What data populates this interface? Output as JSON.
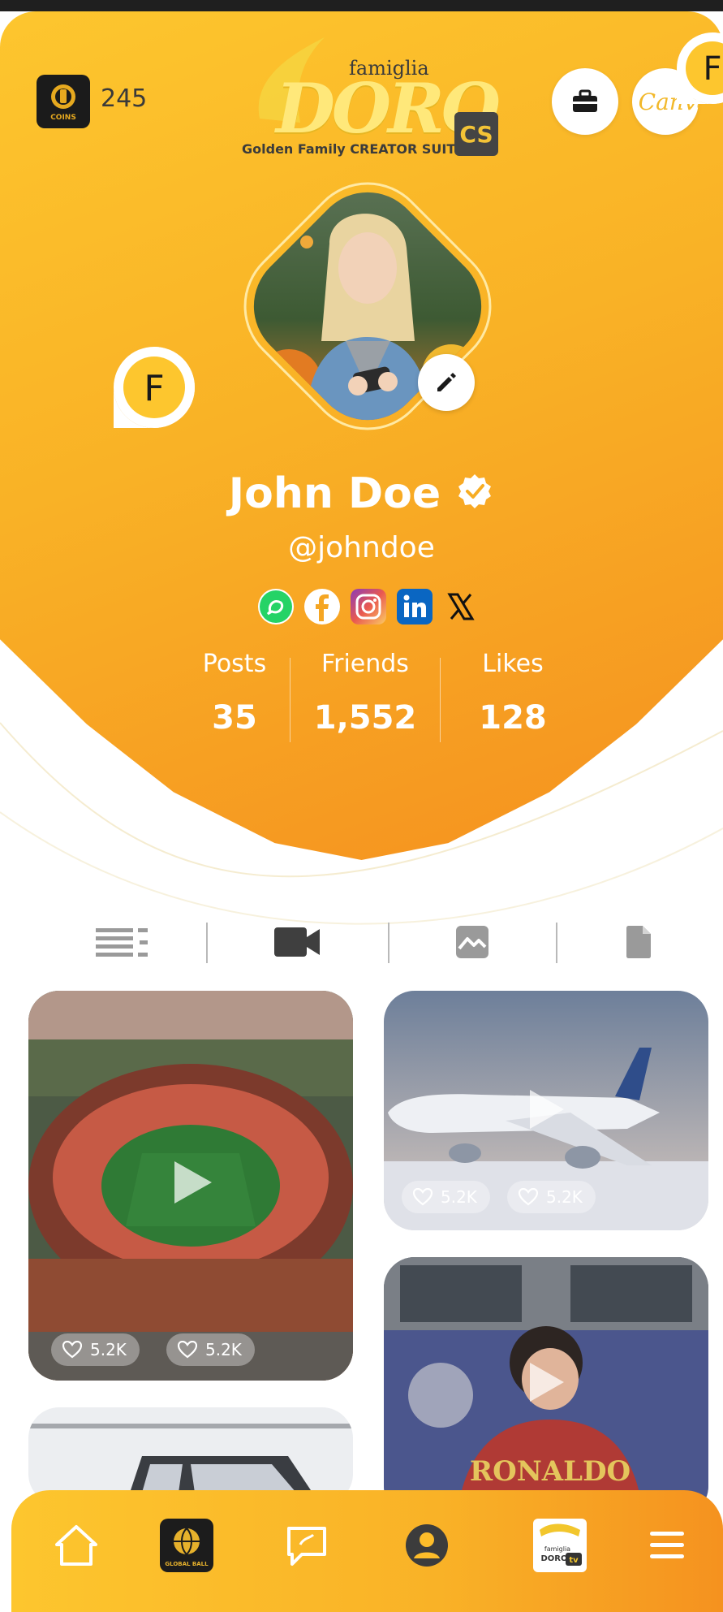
{
  "header": {
    "coins_badge_text": "COINS",
    "coins_count": "245",
    "logo_famiglia": "famiglia",
    "logo_brand": "DORO",
    "logo_tagline": "Golden Family CREATOR SUITE",
    "logo_badge": "CS",
    "chip_letter": "F",
    "canva_label": "Canva"
  },
  "profile": {
    "name": "John Doe",
    "handle": "@johndoe",
    "avatar_chip_letter": "F",
    "socials": [
      "whatsapp",
      "facebook",
      "instagram",
      "linkedin",
      "x"
    ],
    "stats": [
      {
        "label": "Posts",
        "value": "35"
      },
      {
        "label": "Friends",
        "value": "1,552"
      },
      {
        "label": "Likes",
        "value": "128"
      }
    ]
  },
  "tabs": [
    "list-icon",
    "video-icon",
    "image-icon",
    "document-icon"
  ],
  "posts": [
    {
      "subject": "stadium",
      "likes": [
        "5.2K",
        "5.2K"
      ]
    },
    {
      "subject": "airplane",
      "likes": [
        "5.2K",
        "5.2K"
      ]
    },
    {
      "subject": "ronaldo",
      "jersey_text": "RONALDO"
    },
    {
      "subject": "car"
    }
  ],
  "bottom_nav": {
    "items": [
      "home-icon",
      "global-ball-icon",
      "chat-icon",
      "profile-icon",
      "doro-tv-icon",
      "menu-icon"
    ],
    "globe_badge_text": "GLOBAL BALL",
    "doro_tv_famiglia": "famiglia",
    "doro_tv_doro": "DORO",
    "doro_tv_tv": "tv"
  },
  "colors": {
    "hero_start": "#fdc62e",
    "hero_end": "#f5901f",
    "accent_dark": "#444444"
  }
}
